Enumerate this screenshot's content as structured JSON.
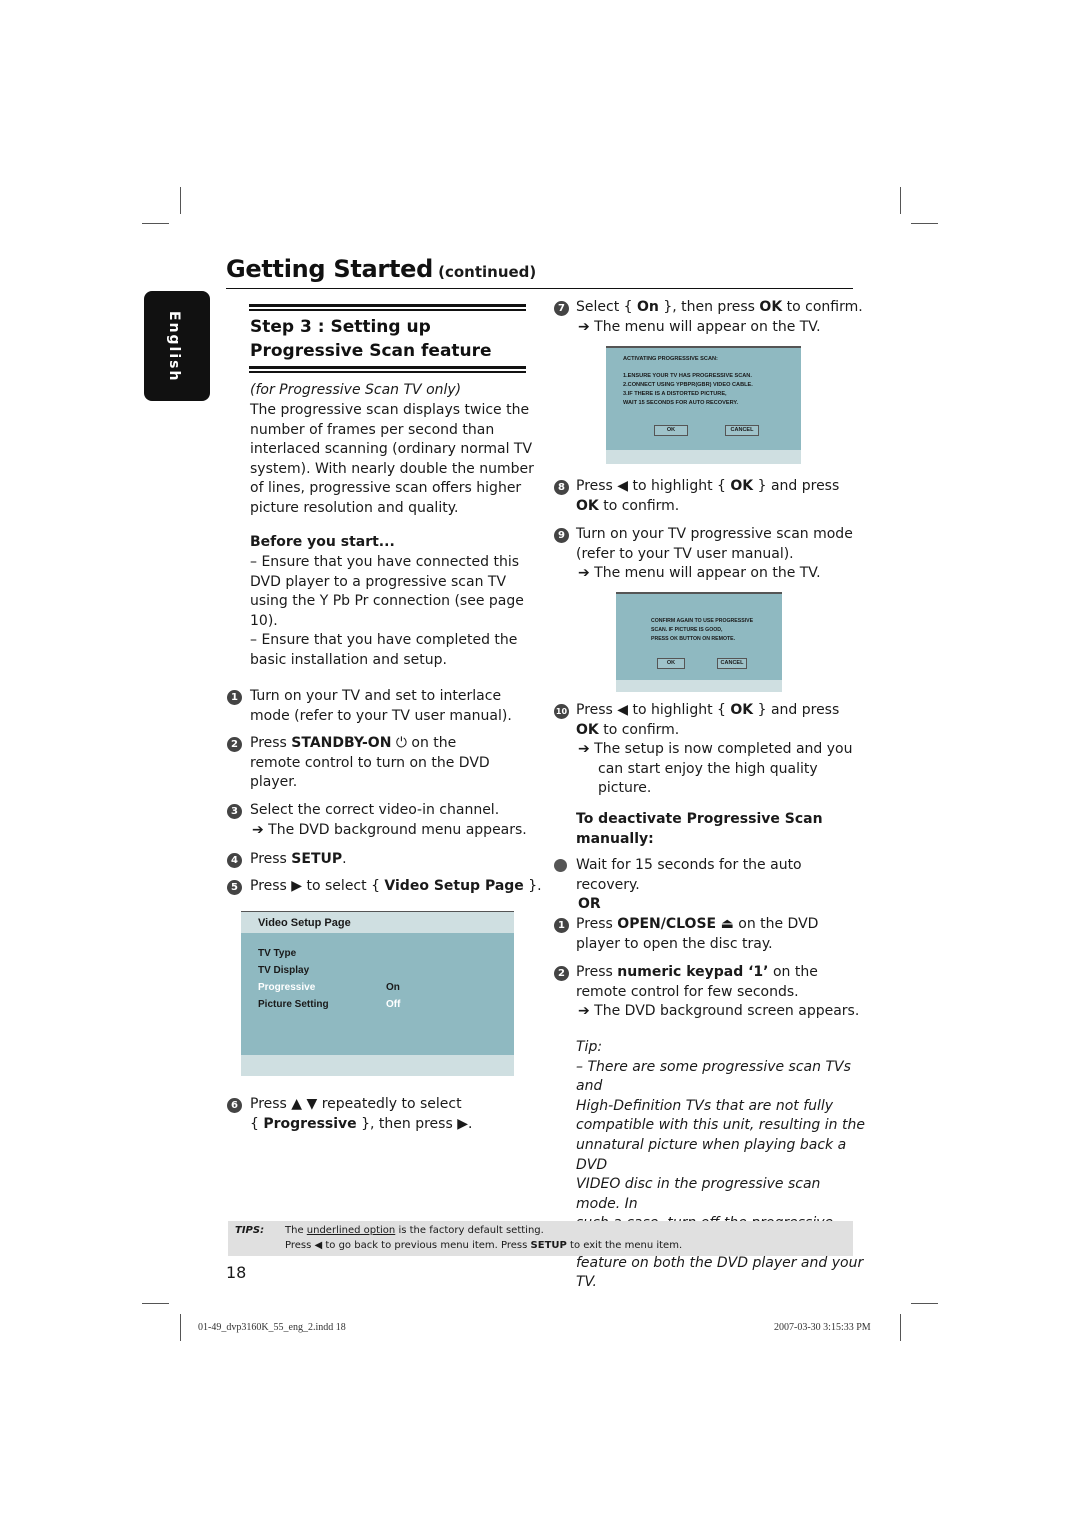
{
  "header": {
    "title": "Getting Started",
    "continued": "(continued)"
  },
  "language_tab": "English",
  "step": {
    "title_line1": "Step 3 : Setting up",
    "title_line2": "Progressive Scan feature"
  },
  "intro": {
    "note": "(for Progressive Scan TV only)",
    "lines": [
      "The progressive scan displays twice the",
      "number of frames per second than",
      "interlaced scanning (ordinary normal TV",
      "system). With nearly double the number",
      "of lines, progressive scan offers higher",
      "picture resolution and quality."
    ]
  },
  "before_start": {
    "heading": "Before you start...",
    "lines": [
      "– Ensure that you have connected this",
      "DVD player to a progressive scan TV",
      "using the Y Pb Pr connection (see page",
      "10).",
      "– Ensure that you have completed the",
      "basic installation and setup."
    ]
  },
  "steps_left": {
    "s1": {
      "num": "1",
      "line1": "Turn on your TV and set to interlace",
      "line2": "mode (refer to your TV user manual)."
    },
    "s2": {
      "num": "2",
      "pre": "Press ",
      "key": "STANDBY-ON",
      "icon": "⏻",
      "post": " on the",
      "line2": "remote control to turn on the DVD",
      "line3": "player."
    },
    "s3": {
      "num": "3",
      "line1": "Select the correct video-in channel.",
      "result": "➔ The DVD background menu appears."
    },
    "s4": {
      "num": "4",
      "pre": "Press ",
      "key": "SETUP",
      "post": "."
    },
    "s5": {
      "num": "5",
      "pre": "Press ▶ to select { ",
      "key": "Video Setup Page",
      "post": " }."
    },
    "s6": {
      "num": "6",
      "line1": "Press ▲ ▼ repeatedly to select",
      "pre2": "{ ",
      "key": "Progressive",
      "post2": " }, then press ▶."
    }
  },
  "video_setup_page": {
    "title": "Video Setup Page",
    "items": [
      {
        "label": "TV Type",
        "value": ""
      },
      {
        "label": "TV Display",
        "value": ""
      },
      {
        "label": "Progressive",
        "value": "On"
      },
      {
        "label": "Picture Setting",
        "value": "Off"
      }
    ]
  },
  "steps_right": {
    "s7": {
      "num": "7",
      "pre": "Select { ",
      "key1": "On",
      "mid": " }, then press ",
      "key2": "OK",
      "post": " to confirm.",
      "result": "➔ The menu will appear on the TV."
    },
    "s8": {
      "num": "8",
      "pre": "Press ◀ to highlight { ",
      "key": "OK",
      "post": " } and press",
      "key2": "OK",
      "post2": " to confirm."
    },
    "s9": {
      "num": "9",
      "line1": "Turn on your TV progressive scan mode",
      "line2": "(refer to your TV user manual).",
      "result": "➔ The menu will appear on the TV."
    },
    "s10": {
      "num": "10",
      "pre": "Press ◀ to highlight { ",
      "key": "OK",
      "post": " } and press",
      "key2": "OK",
      "post2": " to confirm.",
      "result1": "➔ The setup is now completed and you",
      "result2": "can start enjoy the high quality",
      "result3": "picture."
    }
  },
  "osd_activating": {
    "title": "ACTIVATING PROGRESSIVE SCAN:",
    "lines": [
      "1.ENSURE  YOUR  TV  HAS  PROGRESSIVE  SCAN.",
      "2.CONNECT  USING  YPBPR(GBR)  VIDEO  CABLE.",
      "3.IF  THERE  IS  A  DISTORTED  PICTURE,",
      "WAIT  15  SECONDS  FOR  AUTO  RECOVERY."
    ],
    "ok": "OK",
    "cancel": "CANCEL"
  },
  "osd_confirm": {
    "lines": [
      "CONFIRM AGAIN TO USE PROGRESSIVE",
      "SCAN. IF PICTURE IS GOOD,",
      "PRESS OK BUTTON ON REMOTE."
    ],
    "ok": "OK",
    "cancel": "CANCEL"
  },
  "deactivate": {
    "heading_line1": "To deactivate Progressive Scan",
    "heading_line2": "manually:",
    "bullet_line1": "Wait for 15 seconds for the auto",
    "bullet_line2": "recovery.",
    "or": "OR",
    "d1": {
      "num": "1",
      "pre": "Press ",
      "key": "OPEN/CLOSE",
      "icon": "⏏",
      "post": " on the DVD",
      "line2": "player to open the disc tray."
    },
    "d2": {
      "num": "2",
      "pre": "Press ",
      "key": "numeric keypad ‘1’",
      "post": " on the",
      "line2": "remote control for few seconds.",
      "result": "➔ The DVD background screen appears."
    }
  },
  "tip": {
    "label": "Tip:",
    "lines": [
      "– There are some progressive scan TVs and",
      "High-Definition TVs that are not fully",
      "compatible with this unit, resulting in the",
      "unnatural picture when playing back a DVD",
      "VIDEO disc in the progressive scan mode. In",
      "such a case, turn off the progressive scan",
      "feature on both the DVD player and your TV."
    ]
  },
  "tips_bar": {
    "label": "TIPS:",
    "line1_pre": "The ",
    "line1_underlined": "underlined option",
    "line1_post": " is the factory default setting.",
    "line2_pre": "Press  ◀ to go back to previous menu item. Press ",
    "line2_key": "SETUP",
    "line2_post": " to exit the menu item."
  },
  "page_number": "18",
  "slug": {
    "file": "01-49_dvp3160K_55_eng_2.indd   18",
    "timestamp": "2007-03-30   3:15:33 PM"
  }
}
